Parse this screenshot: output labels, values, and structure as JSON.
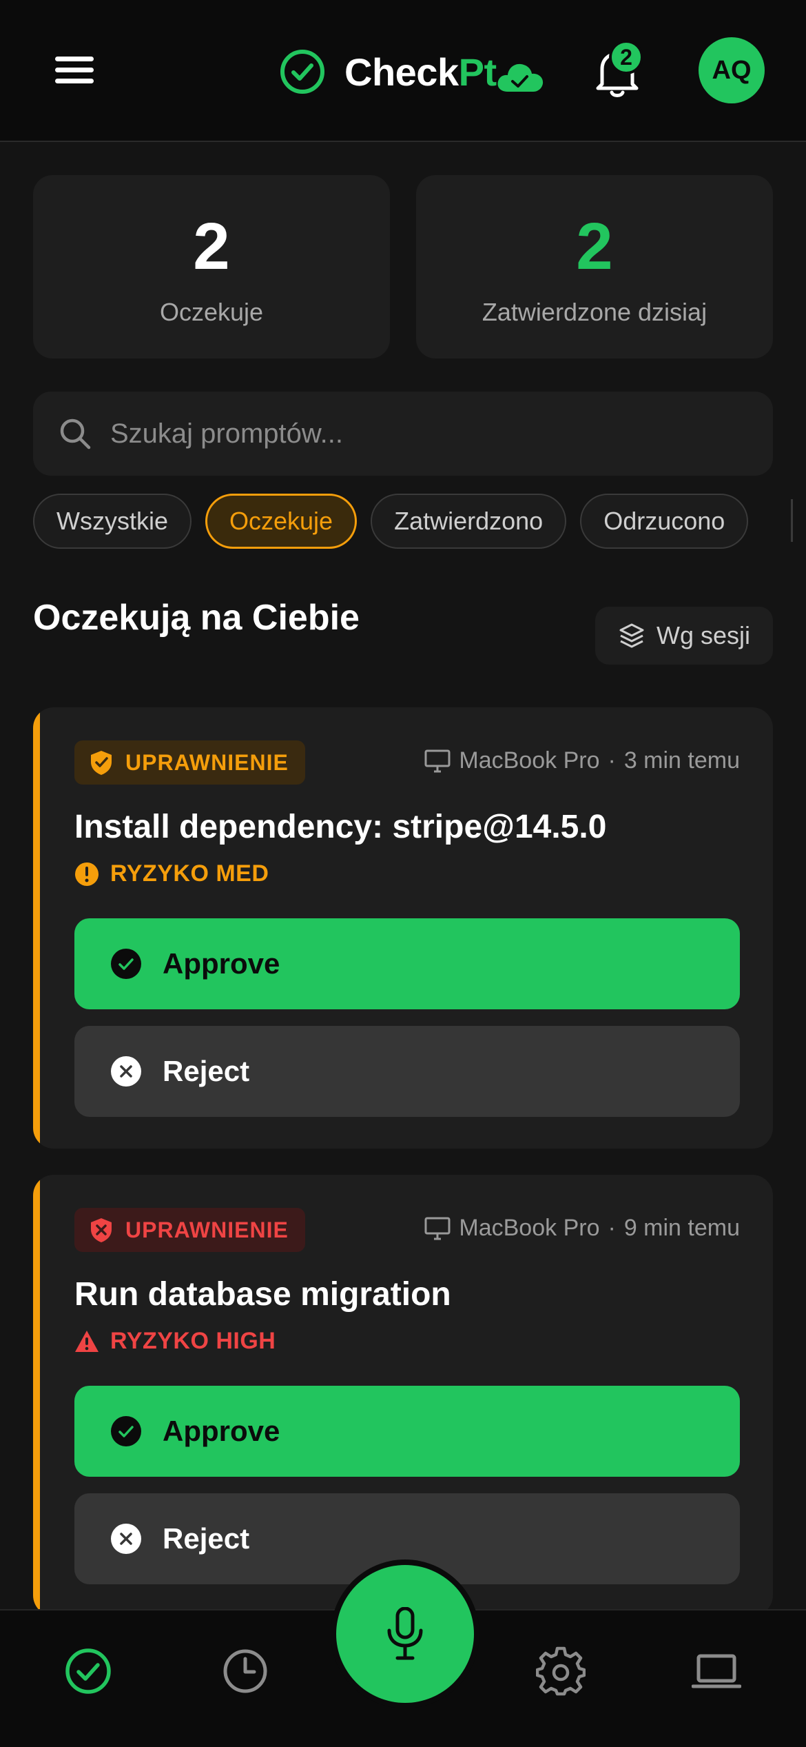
{
  "header": {
    "brand_prefix": "Check",
    "brand_suffix": "Pt",
    "notification_count": "2",
    "avatar_initials": "AQ"
  },
  "stats": [
    {
      "value": "2",
      "label": "Oczekuje",
      "color": "#ffffff"
    },
    {
      "value": "2",
      "label": "Zatwierdzone dzisiaj",
      "color": "#22c55e"
    }
  ],
  "search": {
    "placeholder": "Szukaj promptów..."
  },
  "filters": {
    "items": [
      "Wszystkie",
      "Oczekuje",
      "Zatwierdzono",
      "Odrzucono"
    ],
    "selected": "Oczekuje"
  },
  "section": {
    "title": "Oczekują na Ciebie",
    "group_button": "Wg sesji"
  },
  "cards": [
    {
      "badge": "UPRAWNIENIE",
      "device": "MacBook Pro",
      "time": "3 min temu",
      "title": "Install dependency: stripe@14.5.0",
      "risk": "RYZYKO MED",
      "approve": "Approve",
      "reject": "Reject"
    },
    {
      "badge": "UPRAWNIENIE",
      "device": "MacBook Pro",
      "time": "9 min temu",
      "title": "Run database migration",
      "risk": "RYZYKO HIGH",
      "approve": "Approve",
      "reject": "Reject"
    }
  ],
  "meta_separator": "·",
  "colors": {
    "accent": "#22c55e",
    "warning": "#f59e0b",
    "danger": "#ef4444",
    "background": "#141414"
  },
  "bottom_nav": {
    "icons": [
      "check-circle-icon",
      "clock-icon",
      "microphone-icon",
      "gear-icon",
      "laptop-icon"
    ],
    "active": "check-circle-icon"
  }
}
